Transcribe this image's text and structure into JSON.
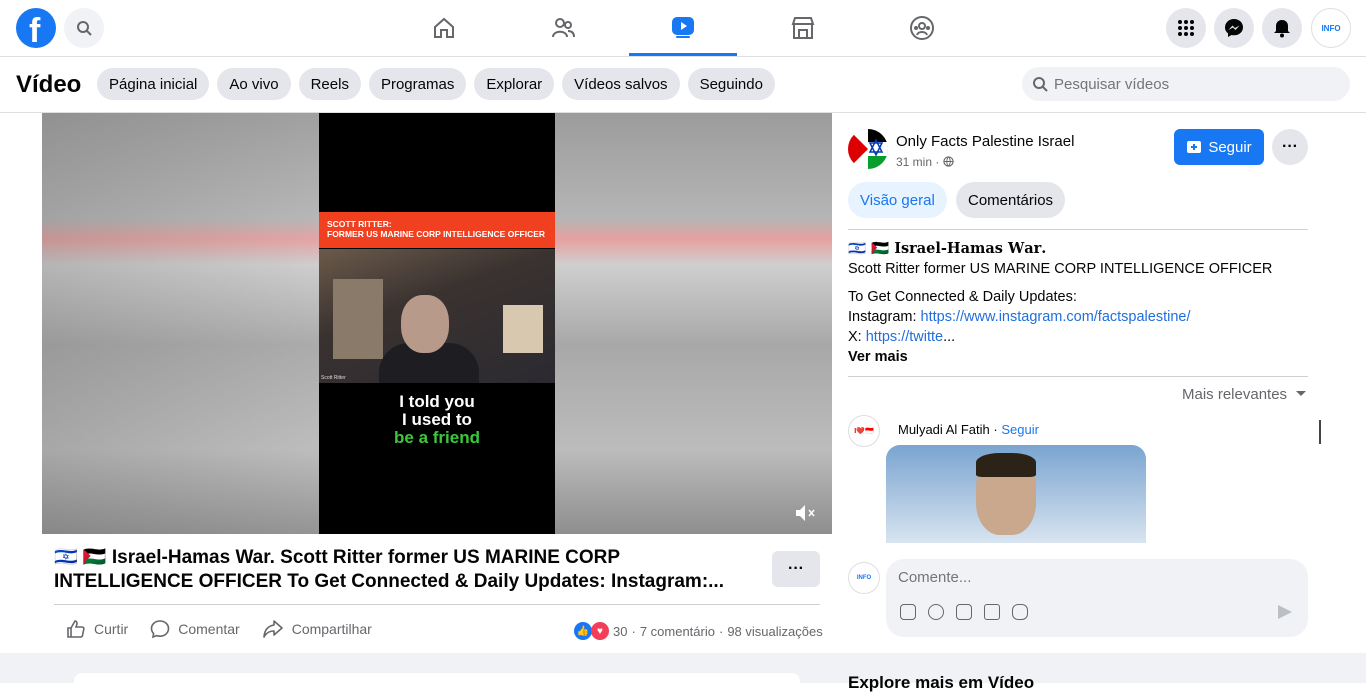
{
  "topnav": {
    "logo_alt": "facebook",
    "tabs": [
      "home",
      "friends",
      "video",
      "marketplace",
      "groups"
    ],
    "active_tab": "video",
    "profile_badge": "INFO"
  },
  "subnav": {
    "title": "Vídeo",
    "chips": [
      "Página inicial",
      "Ao vivo",
      "Reels",
      "Programas",
      "Explorar",
      "Vídeos salvos",
      "Seguindo"
    ],
    "search_placeholder": "Pesquisar vídeos"
  },
  "video": {
    "banner_line1": "SCOTT RITTER:",
    "banner_line2": "FORMER US MARINE CORP INTELLIGENCE OFFICER",
    "nametag": "Scott Ritter",
    "caption_line1": "I told you",
    "caption_line2": "I used to",
    "caption_line3": "be a friend",
    "title_line1": "🇮🇱 🇵🇸 Israel-Hamas War. Scott Ritter former US MARINE CORP",
    "title_line2": "INTELLIGENCE OFFICER To Get Connected & Daily Updates: Instagram:...",
    "more_label": "···"
  },
  "actions": {
    "like": "Curtir",
    "comment": "Comentar",
    "share": "Compartilhar",
    "reaction_count": "30",
    "comments": "7 comentário",
    "views": "98 visualizações"
  },
  "post": {
    "page_name": "Only Facts Palestine Israel",
    "time": "31 min ·",
    "follow": "Seguir",
    "tab_overview": "Visão geral",
    "tab_comments": "Comentários",
    "desc_title": "🇮🇱 🇵🇸 𝐈𝐬𝐫𝐚𝐞𝐥-𝐇𝐚𝐦𝐚𝐬 𝐖𝐚𝐫.",
    "desc_line2": "Scott Ritter former US MARINE CORP INTELLIGENCE OFFICER",
    "desc_line3": "To Get Connected & Daily Updates:",
    "desc_ig_label": "Instagram: ",
    "desc_ig_link": "https://www.instagram.com/factspalestine/",
    "desc_x_label": "X: ",
    "desc_x_link": "https://twitte",
    "desc_ellipsis": "...",
    "see_more": "Ver mais"
  },
  "comments": {
    "sort": "Mais relevantes",
    "commenter": "Mulyadi Al Fatih",
    "commenter_follow": "Seguir",
    "input_placeholder": "Comente..."
  },
  "footer": {
    "explore": "Explore mais em Vídeo"
  },
  "colors": {
    "brand": "#1877f2",
    "link": "#216fdb",
    "caption_green": "#3cc73c",
    "banner_red": "#f04020"
  }
}
